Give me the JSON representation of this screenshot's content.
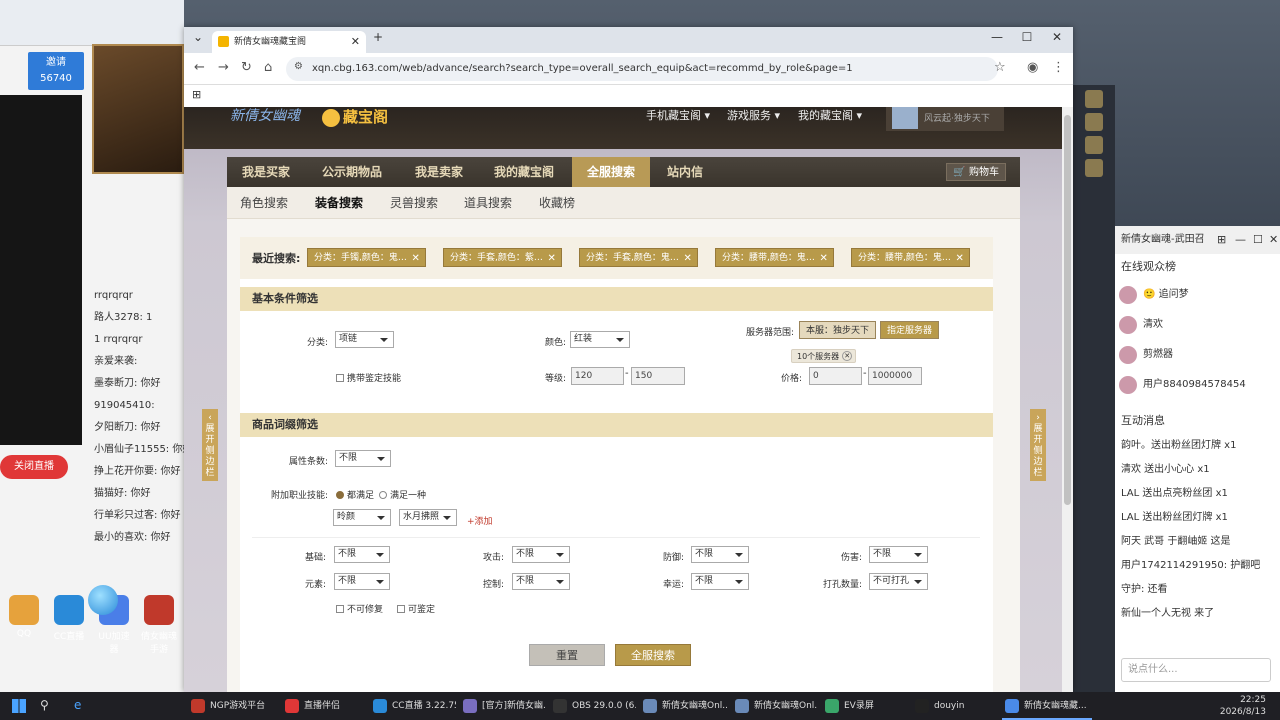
{
  "browser": {
    "tab_title": "新倩女幽魂藏宝阁",
    "url": "xqn.cbg.163.com/web/advance/search?search_type=overall_search_equip&act=recommd_by_role&page=1"
  },
  "site": {
    "logo_text": "新倩女幽魂",
    "logo_brand": "藏宝阁",
    "header_links": [
      "手机藏宝阁 ▾",
      "游戏服务 ▾",
      "我的藏宝阁 ▾"
    ],
    "user_server": "风云起·独步天下"
  },
  "main_nav": [
    "我是买家",
    "公示期物品",
    "我是卖家",
    "我的藏宝阁",
    "全服搜索",
    "站内信"
  ],
  "cart_label": "购物车",
  "sub_nav": [
    "角色搜索",
    "装备搜索",
    "灵兽搜索",
    "道具搜索",
    "收藏榜"
  ],
  "recent": {
    "label": "最近搜索:",
    "chips": [
      "分类：手镯,颜色：鬼…",
      "分类：手套,颜色：紫…",
      "分类：手套,颜色：鬼…",
      "分类：腰带,颜色：鬼…",
      "分类：腰带,颜色：鬼…"
    ]
  },
  "basic": {
    "title": "基本条件筛选",
    "category_label": "分类:",
    "category_value": "项链",
    "color_label": "颜色:",
    "color_value": "红装",
    "server_label": "服务器范围:",
    "server_current": "本服：独步天下",
    "server_specify": "指定服务器",
    "server_count": "10个服务器",
    "skill_checkbox": "携带鉴定技能",
    "level_label": "等级:",
    "level_min": "120",
    "level_max": "150",
    "price_label": "价格:",
    "price_min": "0",
    "price_max": "1000000"
  },
  "attr": {
    "title": "商品词缀筛选",
    "count_label": "属性条数:",
    "count_value": "不限",
    "job_label": "附加职业技能:",
    "radio_all": "都满足",
    "radio_one": "满足一种",
    "job_value": "昤颜",
    "skill_value": "水月拂照",
    "add_link": "+添加",
    "rows": [
      {
        "label": "基础:",
        "value": "不限"
      },
      {
        "label": "攻击:",
        "value": "不限"
      },
      {
        "label": "防御:",
        "value": "不限"
      },
      {
        "label": "伤害:",
        "value": "不限"
      },
      {
        "label": "元素:",
        "value": "不限"
      },
      {
        "label": "控制:",
        "value": "不限"
      },
      {
        "label": "幸运:",
        "value": "不限"
      },
      {
        "label": "打孔数量:",
        "value": "不可打孔"
      }
    ],
    "no_repair": "不可修复",
    "can_appraise": "可鉴定"
  },
  "buttons": {
    "reset": "重置",
    "search": "全服搜索"
  },
  "side_tab": "展开侧边栏",
  "left_panel": {
    "invite_label": "邀请",
    "invite_count": "56740",
    "chat": [
      "rrqrqrqr",
      "路人3278: 1",
      "1  rrqrqrqr",
      "亲爱来袭:",
      "墨泰断刀: 你好",
      "919045410:",
      "夕阳断刀: 你好",
      "小眉仙子11555: 你好",
      "挣上花开你要: 你好",
      "猫猫好: 你好",
      "行单彩只过客: 你好",
      "最小的喜欢: 你好"
    ],
    "close_live": "关闭直播",
    "desk_icons": [
      "QQ",
      "CC直播",
      "UU加速器",
      "倩女幽魂手游"
    ]
  },
  "right_panel": {
    "title": "新倩女幽魂-武田召",
    "viewers_header": "在线观众榜",
    "viewers": [
      "🙂 追问梦",
      "清欢",
      "剪燃器",
      "用户8840984578454"
    ],
    "interact_header": "互动消息",
    "gifts": [
      "韵叶。送出粉丝团灯牌 x1",
      "清欢 送出小心心 x1",
      "LAL 送出点亮粉丝团 x1",
      "LAL 送出粉丝团灯牌 x1",
      "阿天 武哥 于翻岫姬 这是",
      "用户1742114291950: 护翻吧",
      "守护: 还看",
      "新仙一个人无视 来了"
    ],
    "input_placeholder": "说点什么..."
  },
  "taskbar": {
    "items": [
      "NGP游戏平台",
      "直播伴侣",
      "CC直播 3.22.75",
      "[官方]新倩女幽...",
      "OBS 29.0.0 (6...",
      "新倩女幽魂Onl...",
      "新倩女幽魂Onl...",
      "EV录屏",
      "douyin",
      "新倩女幽魂藏..."
    ],
    "time": "22:25",
    "date": "2026/8/13"
  }
}
